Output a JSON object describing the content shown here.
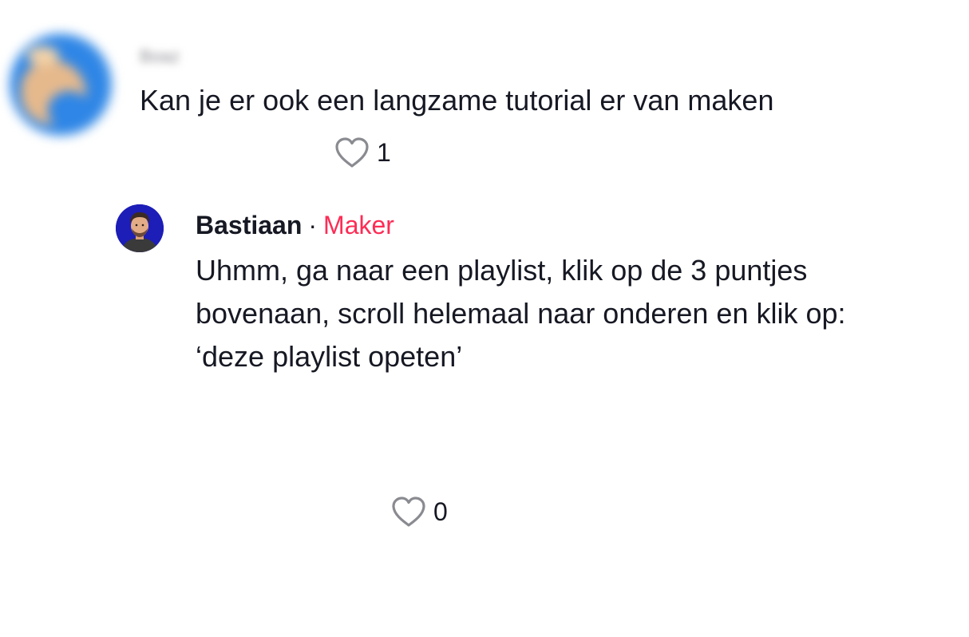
{
  "comment": {
    "username": "Boaz",
    "text": "Kan je er ook een langzame tutorial er van maken",
    "likes": "1",
    "like_icon": "heart-outline-icon"
  },
  "reply": {
    "username": "Bastiaan",
    "separator": "·",
    "badge": "Maker",
    "text_lines": [
      "Uhmm, ga naar een playlist, klik op de 3 puntjes",
      "bovenaan, scroll helemaal naar onderen en klik op:",
      "‘deze playlist opeten’"
    ],
    "likes": "0",
    "like_icon": "heart-outline-icon"
  },
  "colors": {
    "text": "#161823",
    "badge": "#fe2c55",
    "heart_outline": "#8a8b91"
  }
}
